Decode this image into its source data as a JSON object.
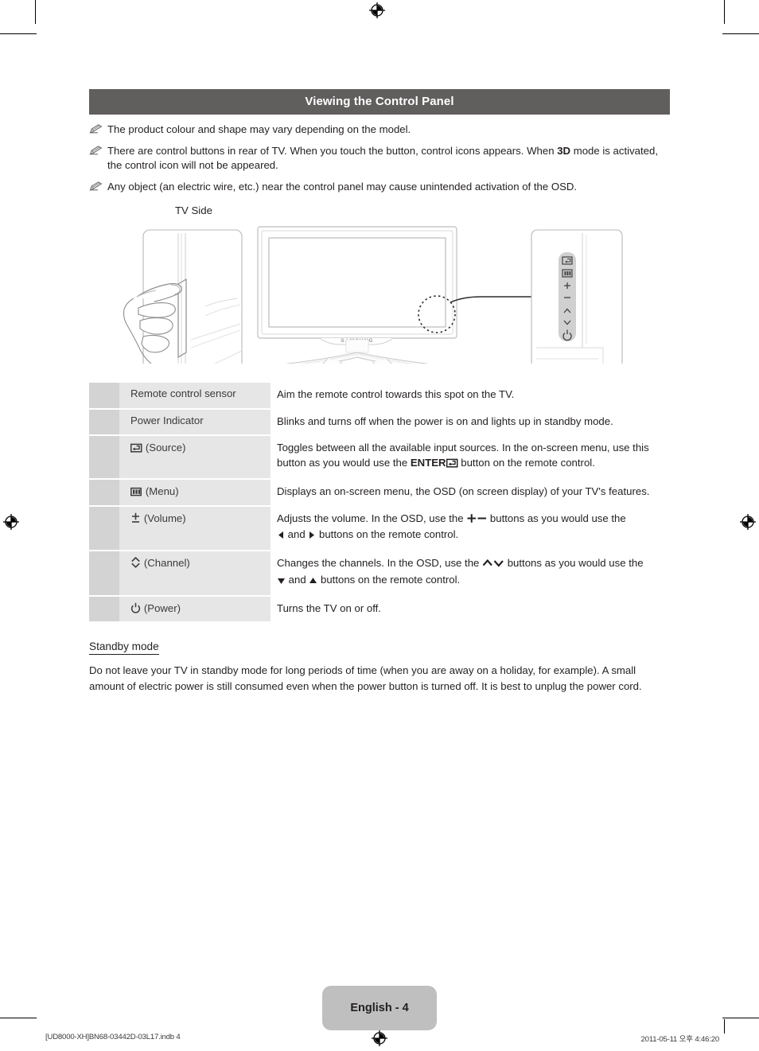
{
  "header": {
    "title": "Viewing the Control Panel",
    "bar_color": "#615e5e"
  },
  "notes": [
    {
      "icon": "pencil-note-icon",
      "text": "The product colour and shape may vary depending on the model."
    },
    {
      "icon": "pencil-note-icon",
      "text_before": "There are control buttons in rear of TV. When you touch the button, control icons appears. When ",
      "bold": "3D",
      "text_after": " mode is activated, the control icon will not be appeared."
    },
    {
      "icon": "pencil-note-icon",
      "text": "Any object (an electric wire, etc.) near the control panel may cause unintended activation of the OSD."
    }
  ],
  "illustration": {
    "side_label": "TV Side",
    "tv_brand": "SAMSUNG",
    "control_strip_icons": [
      "source-enter-icon",
      "menu-icon",
      "volume-plus-icon",
      "volume-minus-icon",
      "channel-up-icon",
      "channel-down-icon",
      "power-icon"
    ],
    "callout": "dashed-circle-callout"
  },
  "table": {
    "rows": [
      {
        "num": "",
        "icon": "",
        "label": "Remote control sensor",
        "desc": "Aim the remote control towards this spot on the TV."
      },
      {
        "num": "",
        "icon": "",
        "label": "Power Indicator",
        "desc": "Blinks and turns off when the power is on and lights up in standby mode."
      },
      {
        "num": "",
        "icon": "source-enter-icon",
        "label": "(Source)",
        "desc_parts": [
          "Toggles between all the available input sources. In the on-screen menu, use this button as you would use the ",
          "ENTER",
          "source-enter-icon",
          " button on the remote control."
        ]
      },
      {
        "num": "",
        "icon": "menu-icon",
        "label": "(Menu)",
        "desc": "Displays an on-screen menu, the OSD (on screen display) of your TV's features."
      },
      {
        "num": "",
        "icon": "volume-plusminus-icon",
        "label": "(Volume)",
        "desc_parts": [
          "Adjusts the volume. In the OSD, use the ",
          "plus-minus-icon",
          " buttons as you would use the ",
          "left-arrow-icon",
          " and ",
          "right-arrow-icon",
          " buttons on the remote control."
        ]
      },
      {
        "num": "",
        "icon": "channel-updown-icon",
        "label": "(Channel)",
        "desc_parts": [
          "Changes the channels. In the OSD, use the ",
          "chevron-up-down-icon",
          " buttons as you would use the ",
          "down-triangle-icon",
          " and ",
          "up-triangle-icon",
          " buttons on the remote control."
        ]
      },
      {
        "num": "",
        "icon": "power-icon",
        "label": "(Power)",
        "desc": "Turns the TV on or off."
      }
    ]
  },
  "standby": {
    "title": "Standby mode",
    "body": "Do not leave your TV in standby mode for long periods of time (when you are away on a holiday, for example). A small amount of electric power is still consumed even when the power button is turned off. It is best to unplug the power cord."
  },
  "footer": {
    "page_badge": "English - 4",
    "file_name": "[UD8000-XH]BN68-03442D-03L17.indb   4",
    "timestamp": "2011-05-11   오후 4:46:20"
  }
}
